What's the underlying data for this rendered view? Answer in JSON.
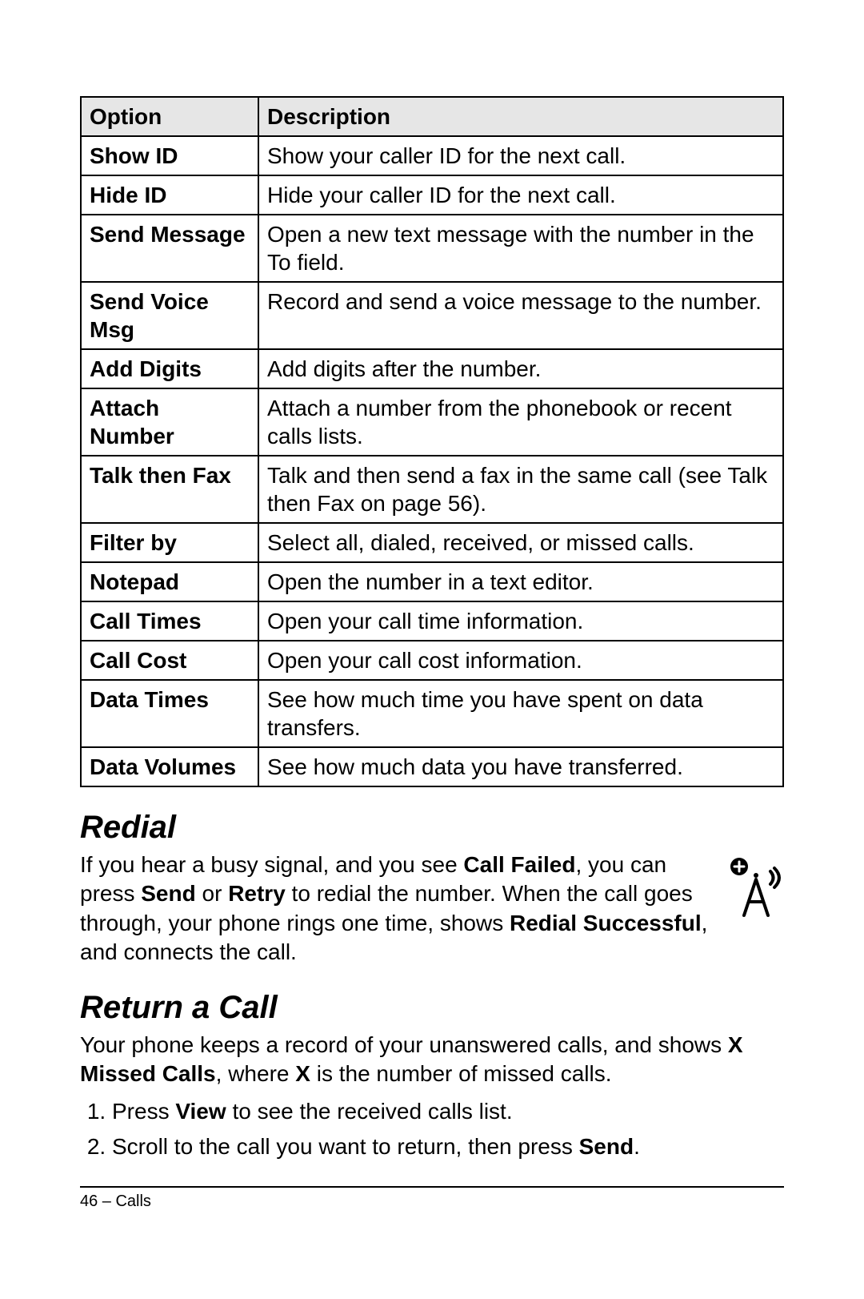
{
  "table": {
    "headers": {
      "option": "Option",
      "description": "Description"
    },
    "rows": [
      {
        "option": "Show ID",
        "description": "Show your caller ID for the next call."
      },
      {
        "option": "Hide ID",
        "description": "Hide your caller ID for the next call."
      },
      {
        "option": "Send Message",
        "description": "Open a new text message with the number in the To field."
      },
      {
        "option": "Send Voice Msg",
        "description": "Record and send a voice message to the number."
      },
      {
        "option": "Add Digits",
        "description": "Add digits after the number."
      },
      {
        "option": "Attach Number",
        "description": "Attach a number from the phonebook or recent calls lists."
      },
      {
        "option": "Talk then Fax",
        "description": "Talk and then send a fax in the same call (see Talk then Fax on page 56)."
      },
      {
        "option": "Filter by",
        "description": "Select all, dialed, received, or missed calls."
      },
      {
        "option": "Notepad",
        "description": "Open the number in a text editor."
      },
      {
        "option": "Call Times",
        "description": "Open your call time information."
      },
      {
        "option": "Call Cost",
        "description": "Open your call cost information."
      },
      {
        "option": "Data Times",
        "description": "See how much time you have spent on data transfers."
      },
      {
        "option": "Data Volumes",
        "description": "See how much data you have transferred."
      }
    ]
  },
  "redial": {
    "heading": "Redial",
    "p1a": "If you hear a busy signal, and you see ",
    "p1b": "Call Failed",
    "p1c": ", you can press ",
    "p1d": "Send",
    "p1e": " or ",
    "p1f": "Retry",
    "p1g": " to redial the number. When the call goes through, your phone rings one time, shows ",
    "p1h": "Redial Successful",
    "p1i": ", and connects the call."
  },
  "return_call": {
    "heading": "Return a Call",
    "p1a": "Your phone keeps a record of your unanswered calls, and shows ",
    "p1b": "X Missed Calls",
    "p1c": ", where ",
    "p1d": "X",
    "p1e": " is the number of missed calls.",
    "step1a": "Press ",
    "step1b": "View",
    "step1c": " to see the received calls list.",
    "step2a": "Scroll to the call you want to return, then press ",
    "step2b": "Send",
    "step2c": "."
  },
  "footer": "46 – Calls"
}
